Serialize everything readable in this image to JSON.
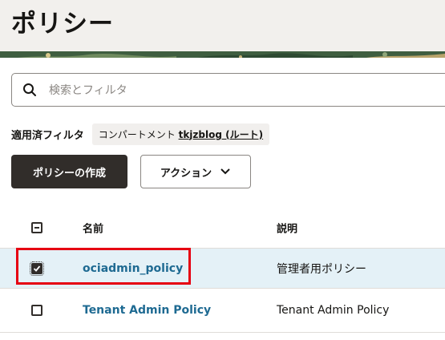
{
  "page": {
    "title": "ポリシー"
  },
  "search": {
    "placeholder": "検索とフィルタ",
    "icon": "search-icon"
  },
  "filters": {
    "label": "適用済フィルタ",
    "chip_prefix": "コンパートメント ",
    "chip_value": "tkjzblog (ルート)"
  },
  "toolbar": {
    "create_label": "ポリシーの作成",
    "actions_label": "アクション"
  },
  "table": {
    "columns": [
      "名前",
      "説明"
    ],
    "rows": [
      {
        "name": "ociadmin_policy",
        "description": "管理者用ポリシー",
        "checked": true
      },
      {
        "name": "Tenant Admin Policy",
        "description": "Tenant Admin Policy",
        "checked": false
      }
    ]
  },
  "colors": {
    "accent_link": "#1e6a92",
    "selected_row": "#e4f1f7",
    "primary_button": "#312d2a",
    "highlight": "#e60012"
  }
}
